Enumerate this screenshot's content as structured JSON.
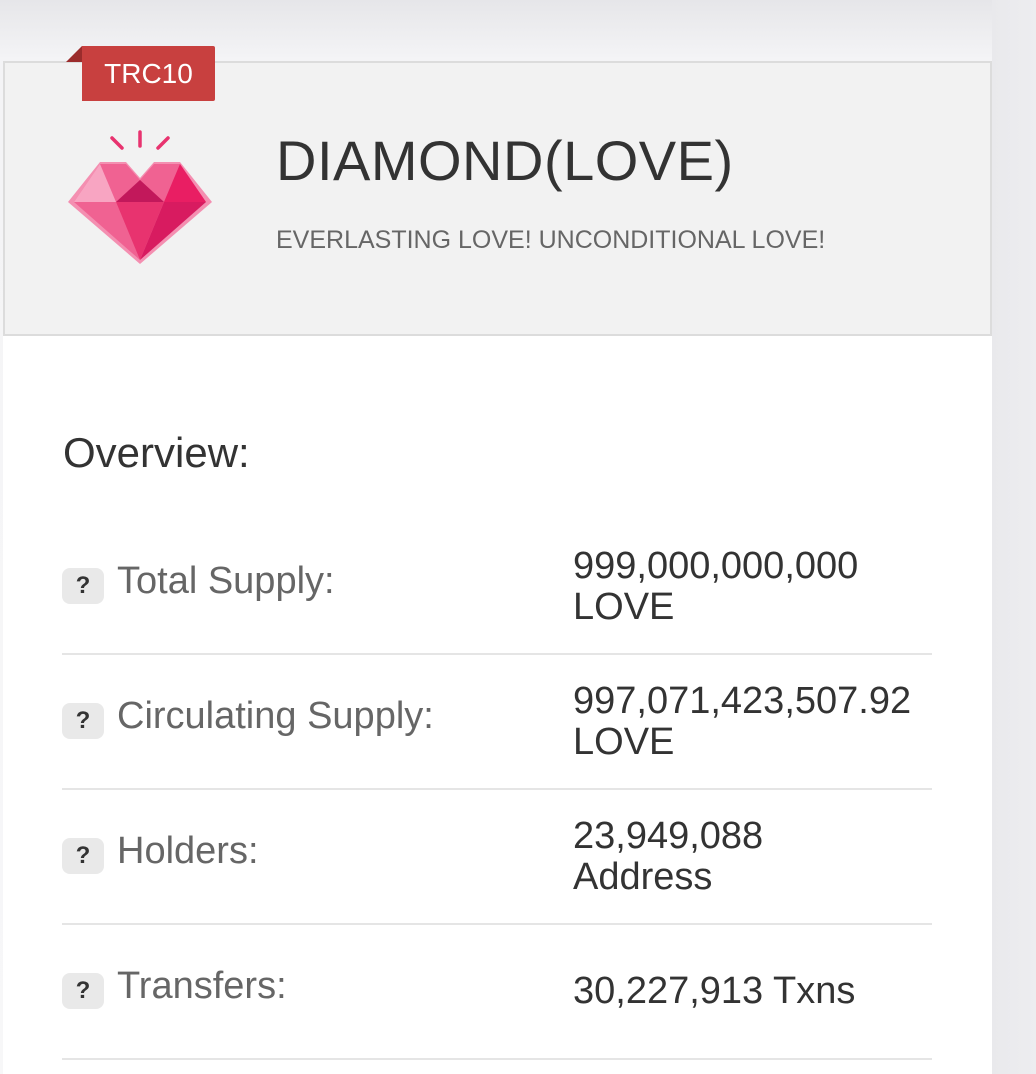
{
  "token": {
    "standard_tag": "TRC10",
    "logo_icon": "pink-diamond-heart-icon",
    "name": "DIAMOND(LOVE)",
    "description": "EVERLASTING LOVE! UNCONDITIONAL LOVE!"
  },
  "overview": {
    "title": "Overview:",
    "help_glyph": "?",
    "rows": [
      {
        "label": "Total Supply:",
        "value_line1": "999,000,000,000",
        "value_line2": "LOVE"
      },
      {
        "label": "Circulating Supply:",
        "value_line1": "997,071,423,507.92",
        "value_line2": "LOVE"
      },
      {
        "label": "Holders:",
        "value_line1": "23,949,088",
        "value_line2": "Address"
      },
      {
        "label": "Transfers:",
        "value_line1": "30,227,913 Txns",
        "value_line2": ""
      }
    ]
  },
  "colors": {
    "tag_red": "#c8403f",
    "diamond_pink": "#e8336f",
    "text_dark": "#333333",
    "text_muted": "#666666"
  }
}
